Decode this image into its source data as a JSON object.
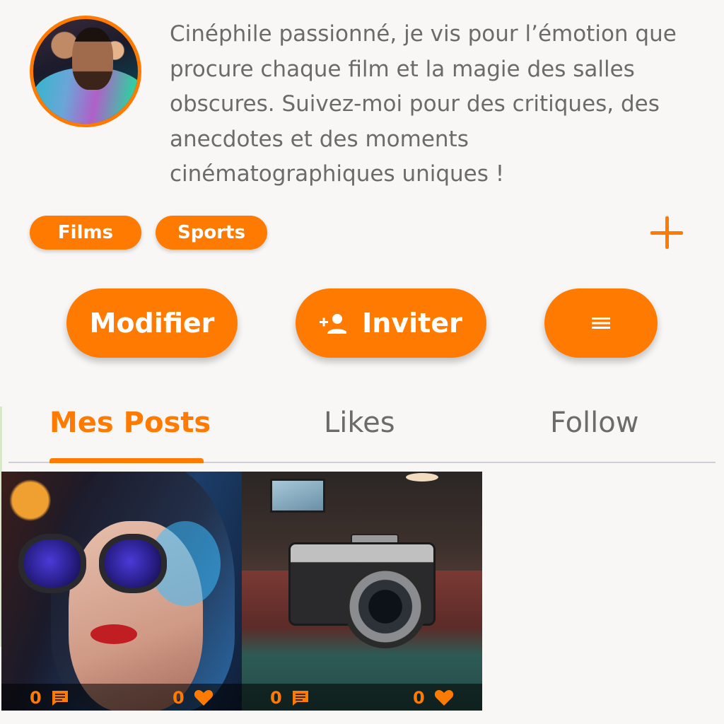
{
  "profile": {
    "bio": "Cinéphile passionné, je vis pour l’émotion que procure chaque film et la magie des salles obscures. Suivez-moi pour des critiques, des anecdotes et des moments cinématographiques uniques !"
  },
  "tags": [
    {
      "label": "Films"
    },
    {
      "label": "Sports"
    }
  ],
  "actions": {
    "edit_label": "Modifier",
    "invite_label": "Inviter"
  },
  "tabs": [
    {
      "label": "Mes Posts",
      "active": true
    },
    {
      "label": "Likes",
      "active": false
    },
    {
      "label": "Follow",
      "active": false
    }
  ],
  "posts": [
    {
      "comments": "0",
      "likes": "0"
    },
    {
      "comments": "0",
      "likes": "0"
    }
  ],
  "colors": {
    "accent": "#ff7a00",
    "text_muted": "#6b6b6b",
    "background": "#f8f7f6"
  },
  "icons": {
    "add_tag": "plus-icon",
    "invite": "person-add-icon",
    "menu": "menu-icon",
    "comments": "comment-icon",
    "likes": "heart-icon"
  }
}
